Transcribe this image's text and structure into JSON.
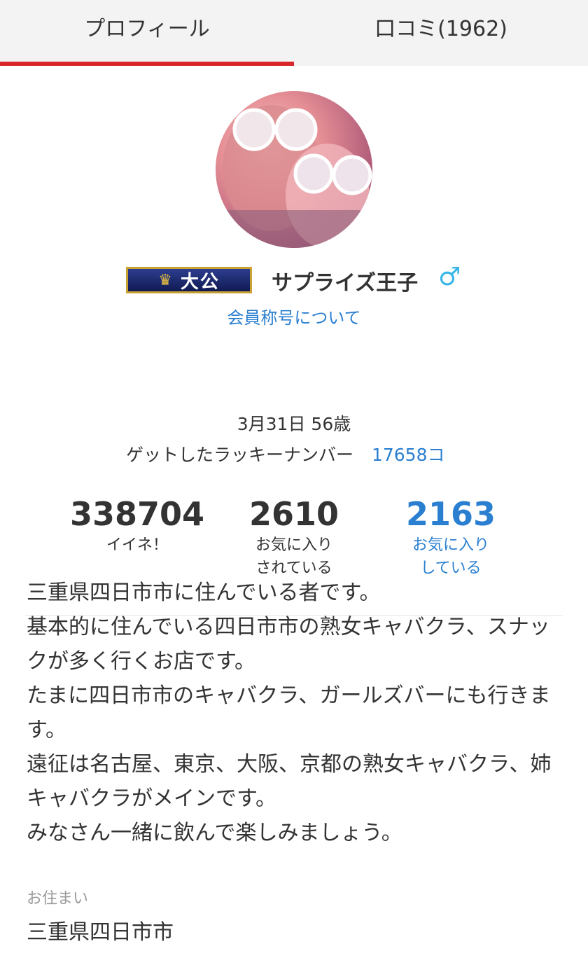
{
  "tabs": [
    {
      "label": "プロフィール",
      "active": true
    },
    {
      "label": "口コミ(1962)",
      "active": false
    }
  ],
  "colors": {
    "accent_red": "#d9262a",
    "link_blue": "#2a7fd0",
    "gender_blue": "#38b6e8"
  },
  "profile": {
    "badge_text": "大公",
    "badge_icon": "crown-icon",
    "username": "サプライズ王子",
    "gender_icon": "male-icon",
    "gender_symbol": "♂",
    "title_link": "会員称号について",
    "birth_age": "3月31日 56歳",
    "lucky_label": "ゲットしたラッキーナンバー",
    "lucky_count": "17658コ"
  },
  "stats": [
    {
      "value": "338704",
      "label": "イイネ！"
    },
    {
      "value": "2610",
      "label": "お気に入り\nされている"
    },
    {
      "value": "2163",
      "label": "お気に入り\nしている"
    }
  ],
  "bio": "三重県四日市市に住んでいる者です。\n基本的に住んでいる四日市市の熟女キャバクラ、スナックが多く行くお店です。\nたまに四日市市のキャバクラ、ガールズバーにも行きます。\n遠征は名古屋、東京、大阪、京都の熟女キャバクラ、姉キャバクラがメインです。\nみなさん一緒に飲んで楽しみましょう。",
  "residence": {
    "label": "お住まい",
    "value": "三重県四日市市"
  }
}
